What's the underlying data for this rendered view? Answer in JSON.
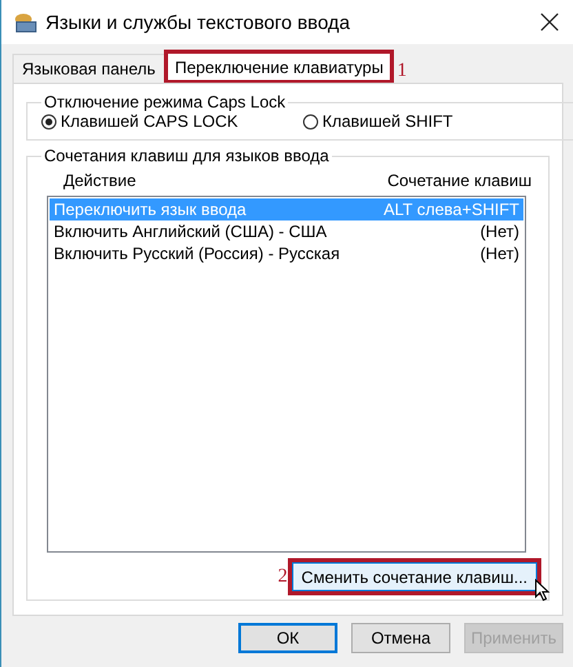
{
  "window": {
    "title": "Языки и службы текстового ввода"
  },
  "tabs": [
    {
      "label": "Языковая панель",
      "selected": false
    },
    {
      "label": "Переключение клавиатуры",
      "selected": true,
      "annotation": "1"
    }
  ],
  "caps_lock": {
    "title": "Отключение режима Caps Lock",
    "options": [
      {
        "label": "Клавишей CAPS LOCK",
        "selected": true
      },
      {
        "label": "Клавишей SHIFT",
        "selected": false
      }
    ]
  },
  "shortcuts": {
    "title": "Сочетания клавиш для языков ввода",
    "columns": [
      "Действие",
      "Сочетание клавиш"
    ],
    "rows": [
      {
        "action": "Переключить язык ввода",
        "keys": "ALT слева+SHIFT",
        "selected": true
      },
      {
        "action": "Включить Английский (США) - США",
        "keys": "(Нет)",
        "selected": false
      },
      {
        "action": "Включить Русский (Россия) - Русская",
        "keys": "(Нет)",
        "selected": false
      }
    ],
    "change_button": {
      "label": "Сменить сочетание клавиш...",
      "annotation": "2"
    }
  },
  "buttons": [
    {
      "label": "ОК",
      "default": true,
      "disabled": false
    },
    {
      "label": "Отмена",
      "default": false,
      "disabled": false
    },
    {
      "label": "Применить",
      "default": false,
      "disabled": true
    }
  ]
}
